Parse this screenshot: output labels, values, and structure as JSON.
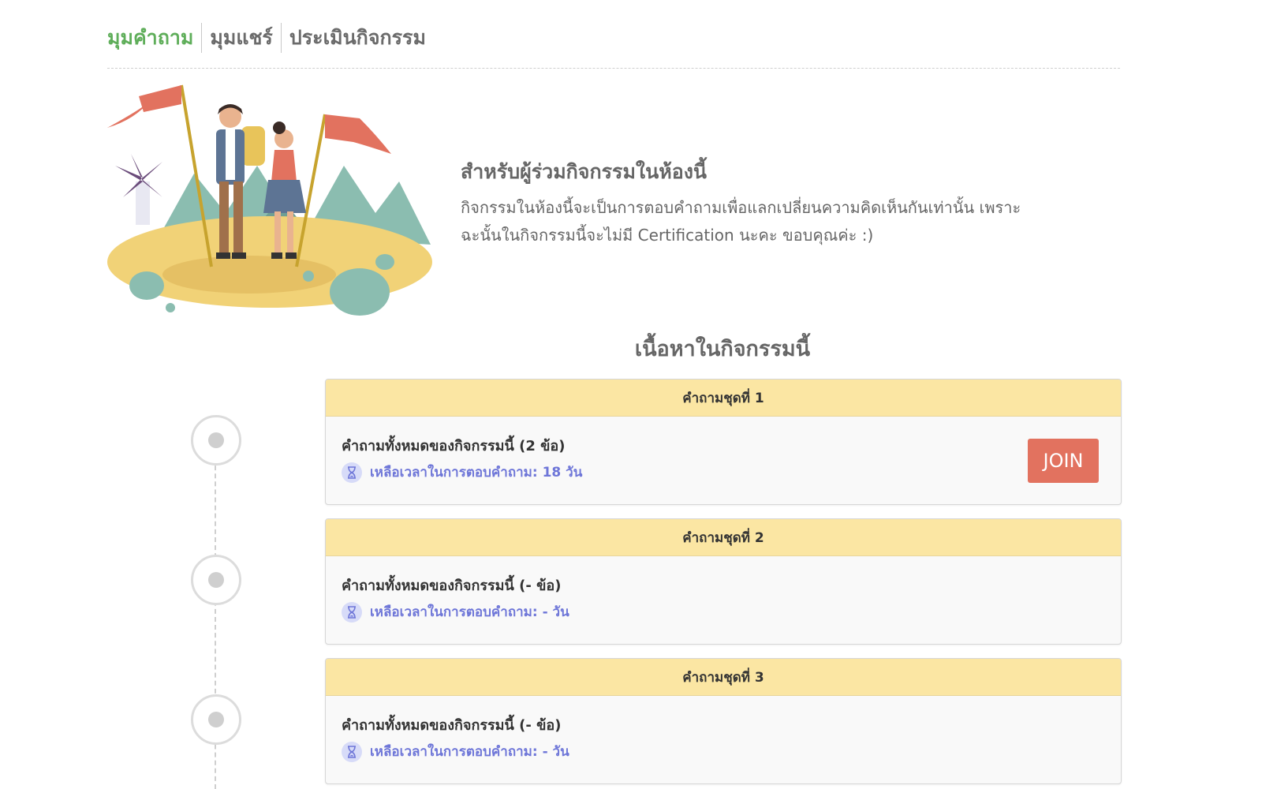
{
  "tabs": [
    {
      "label": "มุมคำถาม",
      "active": true
    },
    {
      "label": "มุมแชร์",
      "active": false
    },
    {
      "label": "ประเมินกิจกรรม",
      "active": false
    }
  ],
  "intro": {
    "title": "สำหรับผู้ร่วมกิจกรรมในห้องนี้",
    "line1": "กิจกรรมในห้องนี้จะเป็นการตอบคำถามเพื่อแลกเปลี่ยนความคิดเห็นกันเท่านั้น เพราะ",
    "line2": "ฉะนั้นในกิจกรรมนี้จะไม่มี Certification นะคะ ขอบคุณค่ะ :)"
  },
  "section_title": "เนื้อหาในกิจกรรมนี้",
  "cards": [
    {
      "header": "คำถามชุดที่ 1",
      "count": "คำถามทั้งหมดของกิจกรรมนี้ (2 ข้อ)",
      "time": "เหลือเวลาในการตอบคำถาม: 18 วัน",
      "button": "JOIN"
    },
    {
      "header": "คำถามชุดที่ 2",
      "count": "คำถามทั้งหมดของกิจกรรมนี้ (- ข้อ)",
      "time": "เหลือเวลาในการตอบคำถาม: - วัน"
    },
    {
      "header": "คำถามชุดที่ 3",
      "count": "คำถามทั้งหมดของกิจกรรมนี้ (- ข้อ)",
      "time": "เหลือเวลาในการตอบคำถาม: - วัน"
    }
  ],
  "colors": {
    "active_tab": "#5fae5a",
    "card_header": "#fbe6a3",
    "join_button": "#e2725f",
    "time_text": "#6e76d8"
  },
  "icons": {
    "timer": "hourglass-icon",
    "timeline": "timeline-node-icon"
  }
}
